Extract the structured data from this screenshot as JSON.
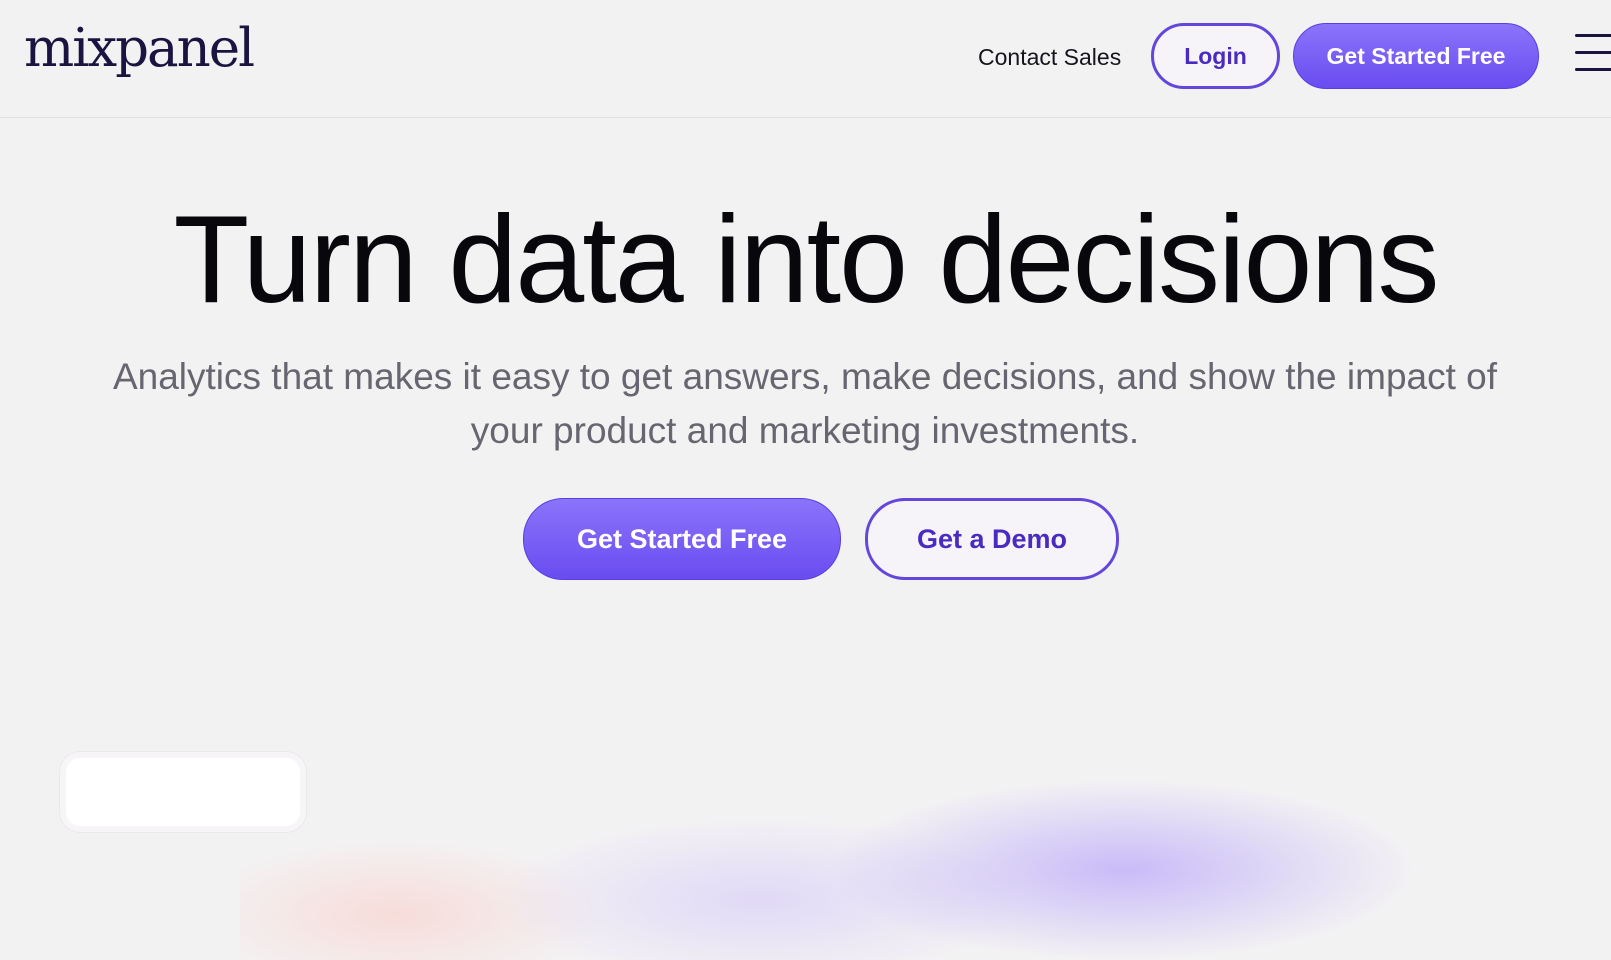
{
  "header": {
    "logo_text": "mixpanel",
    "contact_sales": "Contact Sales",
    "login": "Login",
    "get_started": "Get Started Free",
    "menu_icon": "hamburger-menu-icon"
  },
  "hero": {
    "title": "Turn data into decisions",
    "subtitle": "Analytics that makes it easy to get answers, make decisions, and show the impact of your product and marketing investments.",
    "cta_primary": "Get Started Free",
    "cta_secondary": "Get a Demo"
  },
  "colors": {
    "accent": "#7056f5",
    "accent_text": "#4a2bbf",
    "brand_logo": "#1c1440",
    "background": "#f3f2f3"
  }
}
